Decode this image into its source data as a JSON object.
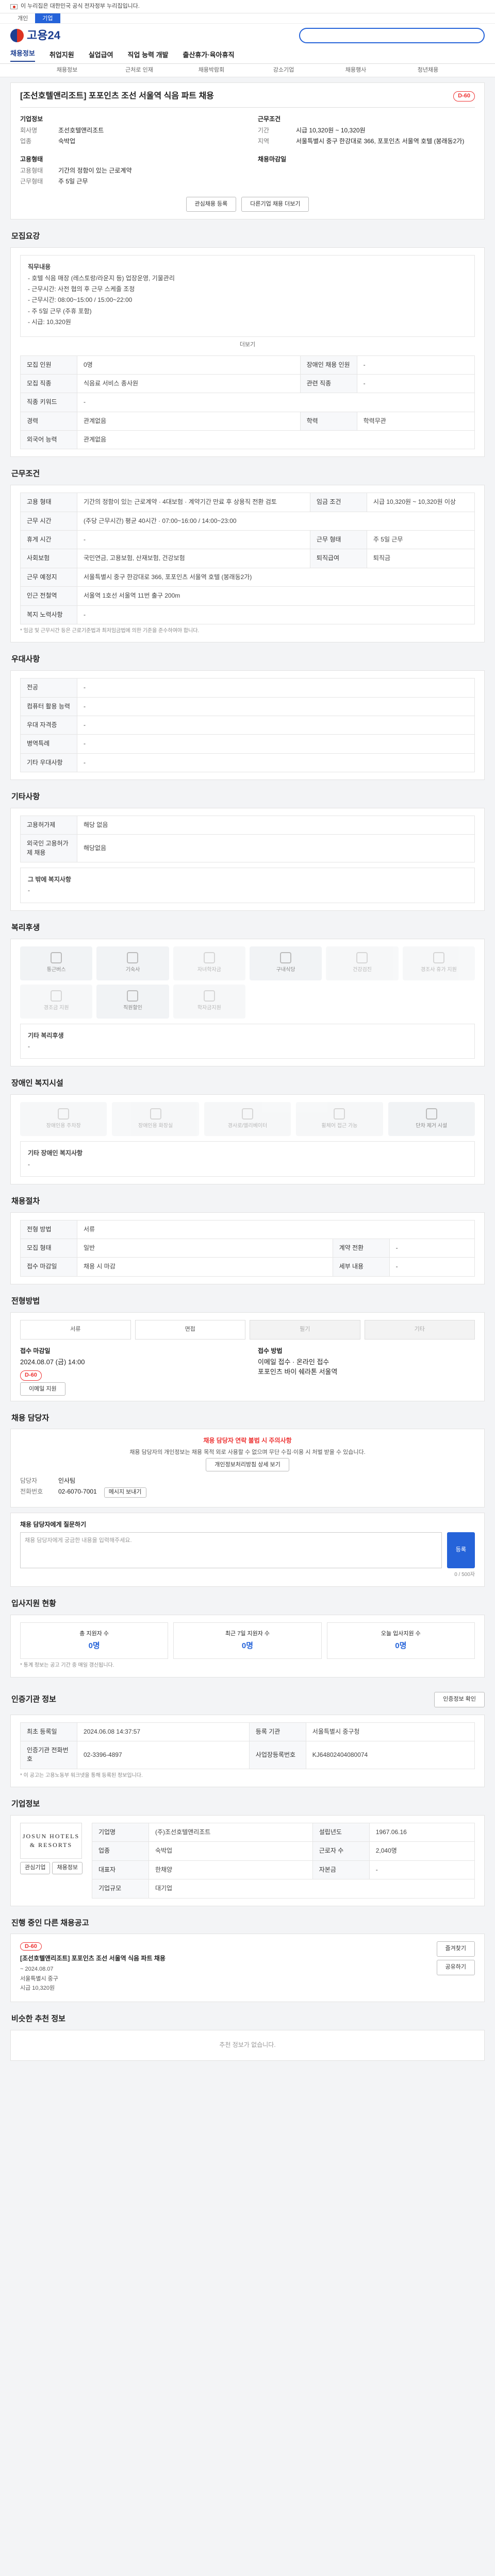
{
  "gov": {
    "text": "이 누리집은 대한민국 공식 전자정부 누리집입니다."
  },
  "top_tabs": [
    "개인",
    "기업"
  ],
  "logo": {
    "text": "고용24"
  },
  "gnb": [
    "채용정보",
    "취업지원",
    "실업급여",
    "직업 능력 개발",
    "출산휴가·육아휴직"
  ],
  "subnav": [
    "채용정보",
    "근처로 인재",
    "채용박람회",
    "강소기업",
    "채용행사",
    "청년채용"
  ],
  "job": {
    "title": "[조선호텔앤리조트] 포포인츠 조선 서울역 식음 파트 채용",
    "dday": "D-60",
    "company_h": "기업정보",
    "company_k1": "회사명",
    "company_v1": "조선호텔앤리조트",
    "company_k2": "업종",
    "company_v2": "숙박업",
    "cond_h": "근무조건",
    "cond_k1": "기간",
    "cond_v1": "시급 10,320원 ~ 10,320원",
    "cond_k2": "지역",
    "cond_v2": "서울특별시 중구 한강대로 366, 포포인츠 서울역 호텔 (봉래동2가)",
    "apply_h": "고용형태",
    "apply_k1": "고용형태",
    "apply_v1": "기간의 정함이 있는 근로계약",
    "apply_k2": "근무형태",
    "apply_v2": "주 5일 근무",
    "deadline_h": "채용마감일",
    "btn_interest": "관심채용 등록",
    "btn_apply": "지원하기",
    "btn_more": "다른기업 채용 더보기"
  },
  "detail": {
    "title": "모집요강",
    "box_h": "직무내용",
    "lines": [
      "- 호텔 식음 매장 (레스토랑/라운지 등) 업장운영, 기물관리",
      "- 근무시간: 사전 협의 후 근무 스케줄 조정",
      "- 근무시간: 08:00~15:00 / 15:00~22:00",
      "- 주 5일 근무 (주휴 포함)",
      "- 시급: 10,320원"
    ],
    "more": "더보기"
  },
  "req_table": [
    [
      "모집 인원",
      "0명",
      "장애인 채용 인원",
      "-"
    ],
    [
      "모집 직종",
      "식음료 서비스 종사원",
      "관련 직종",
      "-"
    ],
    [
      "직종 키워드",
      "-",
      "",
      ""
    ],
    [
      "경력",
      "관계없음",
      "학력",
      "학력무관"
    ],
    [
      "외국어 능력",
      "관계없음",
      "",
      ""
    ]
  ],
  "work": {
    "title": "근무조건",
    "rows": [
      [
        "고용 형태",
        "기간의 정함이 있는 근로계약 · 4대보험 · 계약기간 만료 후 상용직 전환 검토",
        "임금 조건",
        "시급 10,320원 ~ 10,320원 이상"
      ],
      [
        "근무 시간",
        "(주당 근무시간) 평균 40시간 · 07:00~16:00 / 14:00~23:00",
        "",
        ""
      ],
      [
        "휴게 시간",
        "-",
        "근무 형태",
        "주 5일 근무"
      ],
      [
        "사회보험",
        "국민연금, 고용보험, 산재보험, 건강보험",
        "퇴직급여",
        "퇴직금"
      ],
      [
        "근무 예정지",
        "서울특별시 중구 한강대로 366, 포포인츠 서울역 호텔 (봉래동2가)",
        "",
        ""
      ],
      [
        "인근 전철역",
        "서울역 1호선 서울역 11번 출구 200m",
        "",
        ""
      ],
      [
        "복지 노력사항",
        "-",
        "",
        ""
      ]
    ],
    "note": "* 임금 및 근무시간 등은 근로기준법과 최저임금법에 의한 기준을 준수하여야 합니다."
  },
  "pref": {
    "title": "우대사항",
    "rows": [
      [
        "전공",
        "-"
      ],
      [
        "컴퓨터 활용 능력",
        "-"
      ],
      [
        "우대 자격증",
        "-"
      ],
      [
        "병역특례",
        "-"
      ],
      [
        "기타 우대사항",
        "-"
      ]
    ]
  },
  "etc": {
    "title": "기타사항",
    "rows": [
      [
        "고용허가제",
        "해당 없음"
      ],
      [
        "외국인 고용허가제 채용",
        "해당없음"
      ]
    ],
    "extra_h": "그 밖에 복지사항",
    "extra_v": "-"
  },
  "welfare": {
    "title": "복리후생",
    "items": [
      "통근버스",
      "기숙사",
      "자녀학자금",
      "구내식당",
      "건강검진",
      "경조사 휴가 지원",
      "경조금 지원",
      "직원할인",
      "학자금지원"
    ],
    "extra_h": "기타 복리후생",
    "extra_v": "-"
  },
  "disab": {
    "title": "장애인 복지시설",
    "items": [
      "장애인용 주차장",
      "장애인용 화장실",
      "경사로/엘리베이터",
      "휠체어 접근 가능",
      "단차 제거 시설"
    ],
    "extra_h": "기타 장애인 복지사항",
    "extra_v": "-"
  },
  "process": {
    "title": "채용절차",
    "rows": [
      [
        "전형 방법",
        "서류"
      ],
      [
        "모집 형태",
        "일반",
        "계약 전환",
        "-"
      ],
      [
        "접수 마감일",
        "채용 시 마감",
        "세부 내용",
        "-"
      ]
    ]
  },
  "apply_steps": {
    "title": "전형방법",
    "steps": [
      "서류",
      "면접",
      "필기",
      "기타"
    ]
  },
  "apply_info": {
    "h1": "접수 마감일",
    "v1": "2024.08.07 (금) 14:00",
    "badge": "D-60",
    "h2": "접수 방법",
    "v2": "이메일 접수 · 온라인 접수",
    "v3": "포포인츠 바이 쉐라톤 서울역",
    "btn": "이메일 지원"
  },
  "contact": {
    "title": "채용 담당자",
    "warn1": "채용 담당자 연락 불법 시 주의사항",
    "warn2": "채용 담당자의 개인정보는 채용 목적 외로 사용할 수 없으며 무단 수집·이용 시 처벌 받을 수 있습니다.",
    "btn": "개인정보처리방침 상세 보기",
    "k1": "담당자",
    "v1": "인사팀",
    "k2": "전화번호",
    "v2": "02-6070-7001",
    "send": "메시지 보내기"
  },
  "qna": {
    "title": "채용 담당자에게 질문하기",
    "placeholder": "채용 담당자에게 궁금한 내용을 입력해주세요.",
    "btn": "등록",
    "count": "0 / 500자"
  },
  "stats": {
    "title": "입사지원 현황",
    "items": [
      [
        "총 지원자 수",
        "0명"
      ],
      [
        "최근 7일 지원자 수",
        "0명"
      ],
      [
        "오늘 입사지원 수",
        "0명"
      ]
    ],
    "note": "* 통계 정보는 공고 기간 중 매일 갱신됩니다."
  },
  "history": {
    "title": "인증기관 정보",
    "btn": "인증정보 확인",
    "rows": [
      [
        "최초 등록일",
        "2024.06.08 14:37:57",
        "등록 기관",
        "서울특별시 중구청"
      ],
      [
        "인증기관 전화번호",
        "02-3396-4897",
        "사업장등록번호",
        "KJ64802404080074"
      ]
    ],
    "note": "* 이 공고는 고용노동부 워크넷을 통해 등록된 정보입니다."
  },
  "company": {
    "title": "기업정보",
    "logo": "JOSUN HOTELS & RESORTS",
    "rows": [
      [
        "기업명",
        "(주)조선호텔앤리조트",
        "설립년도",
        "1967.06.16"
      ],
      [
        "업종",
        "숙박업",
        "근로자 수",
        "2,040명"
      ],
      [
        "대표자",
        "한채양",
        "자본금",
        "-"
      ],
      [
        "기업규모",
        "대기업",
        "",
        ""
      ]
    ],
    "btn1": "관심기업",
    "btn2": "채용정보"
  },
  "recent": {
    "title": "진행 중인 다른 채용공고",
    "items": [
      {
        "title": "[조선호텔앤리조트] 포포인츠 조선 서울역 식음 파트 채용",
        "dday": "D-60",
        "date": "~ 2024.08.07",
        "area": "서울특별시 중구",
        "pay": "시급 10,320원"
      }
    ],
    "btn1": "즐겨찾기",
    "btn2": "공유하기"
  },
  "similar": {
    "title": "비슷한 추천 정보",
    "empty": "추천 정보가 없습니다."
  }
}
